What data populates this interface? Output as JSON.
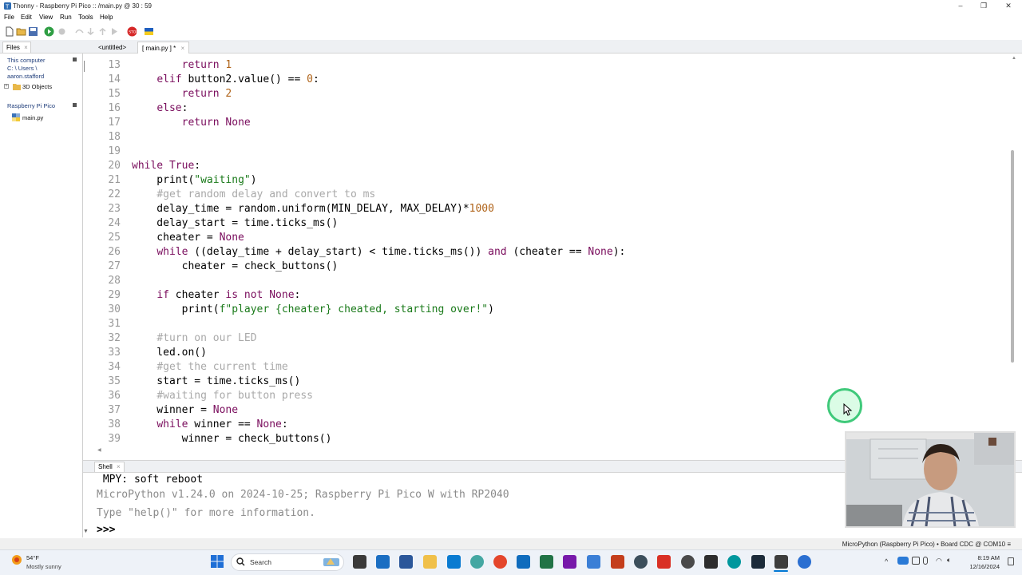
{
  "window": {
    "title": "Thonny  -  Raspberry Pi Pico :: /main.py  @  30 : 59",
    "controls": [
      "–",
      "❐",
      "✕"
    ]
  },
  "menu": [
    "File",
    "Edit",
    "View",
    "Run",
    "Tools",
    "Help"
  ],
  "files_pane": {
    "tab_label": "Files",
    "this_computer": "This computer",
    "path_line1": "C: \\ Users \\",
    "path_line2": "aaron.stafford",
    "local_items": [
      "3D Objects"
    ],
    "device_header": "Raspberry Pi Pico",
    "device_items": [
      "main.py"
    ]
  },
  "editor": {
    "tabs": [
      {
        "label": "<untitled>",
        "active": false
      },
      {
        "label": "[ main.py ] *",
        "active": true
      }
    ],
    "cursor_position": "30 : 59"
  },
  "code_lines": [
    {
      "n": "13",
      "html": "        <span class=\"kw\">return</span> <span class=\"num\">1</span>"
    },
    {
      "n": "14",
      "html": "    <span class=\"kw\">elif</span> button2.value() == <span class=\"num\">0</span>:"
    },
    {
      "n": "15",
      "html": "        <span class=\"kw\">return</span> <span class=\"num\">2</span>"
    },
    {
      "n": "16",
      "html": "    <span class=\"kw\">else</span>:"
    },
    {
      "n": "17",
      "html": "        <span class=\"kw\">return</span> <span class=\"kw\">None</span>"
    },
    {
      "n": "18",
      "html": ""
    },
    {
      "n": "19",
      "html": ""
    },
    {
      "n": "20",
      "html": "<span class=\"kw\">while</span> <span class=\"kw\">True</span>:"
    },
    {
      "n": "21",
      "html": "    print(<span class=\"str\">\"waiting\"</span>)"
    },
    {
      "n": "22",
      "html": "    <span class=\"cm\">#get random delay and convert to ms</span>"
    },
    {
      "n": "23",
      "html": "    delay_time = random.uniform(MIN_DELAY, MAX_DELAY)*<span class=\"num\">1000</span>"
    },
    {
      "n": "24",
      "html": "    delay_start = time.ticks_ms()"
    },
    {
      "n": "25",
      "html": "    cheater = <span class=\"kw\">None</span>"
    },
    {
      "n": "26",
      "html": "    <span class=\"kw\">while</span> ((delay_time + delay_start) &lt; time.ticks_ms()) <span class=\"kw\">and</span> (cheater == <span class=\"kw\">None</span>):"
    },
    {
      "n": "27",
      "html": "        cheater = check_buttons()"
    },
    {
      "n": "28",
      "html": ""
    },
    {
      "n": "29",
      "html": "    <span class=\"kw\">if</span> cheater <span class=\"kw\">is not</span> <span class=\"kw\">None</span>:"
    },
    {
      "n": "30",
      "html": "        print(<span class=\"str\">f\"player {cheater} cheated, starting over!\"</span>)"
    },
    {
      "n": "31",
      "html": ""
    },
    {
      "n": "32",
      "html": "    <span class=\"cm\">#turn on our LED</span>"
    },
    {
      "n": "33",
      "html": "    led.on()"
    },
    {
      "n": "34",
      "html": "    <span class=\"cm\">#get the current time</span>"
    },
    {
      "n": "35",
      "html": "    start = time.ticks_ms()"
    },
    {
      "n": "36",
      "html": "    <span class=\"cm\">#waiting for button press</span>"
    },
    {
      "n": "37",
      "html": "    winner = <span class=\"kw\">None</span>"
    },
    {
      "n": "38",
      "html": "    <span class=\"kw\">while</span> winner == <span class=\"kw\">None</span>:"
    },
    {
      "n": "39",
      "html": "        winner = check_buttons()"
    }
  ],
  "shell": {
    "tab_label": "Shell",
    "lines": [
      {
        "text": " MPY: soft reboot",
        "color": "#000000"
      },
      {
        "text": "MicroPython v1.24.0 on 2024-10-25; Raspberry Pi Pico W with RP2040",
        "color": "#8a8a8a"
      },
      {
        "text": "Type \"help()\" for more information.",
        "color": "#8a8a8a"
      },
      {
        "text": ">>>",
        "color": "#000000"
      }
    ]
  },
  "status_bar": {
    "interpreter": "MicroPython (Raspberry Pi Pico)  •  Board CDC @ COM10  ≡"
  },
  "taskbar": {
    "weather_temp": "54°F",
    "weather_desc": "Mostly sunny",
    "search_label": "Search",
    "time": "8:19 AM",
    "date": "12/16/2024",
    "colors": {
      "start": "#1f6fd6",
      "accent": "#0078d4"
    }
  },
  "colors": {
    "keyword": "#7a0d5d",
    "string": "#1a7a1a",
    "number": "#b0641a",
    "comment": "#a9a9a9",
    "cursor_ring": "#3fc97a"
  }
}
